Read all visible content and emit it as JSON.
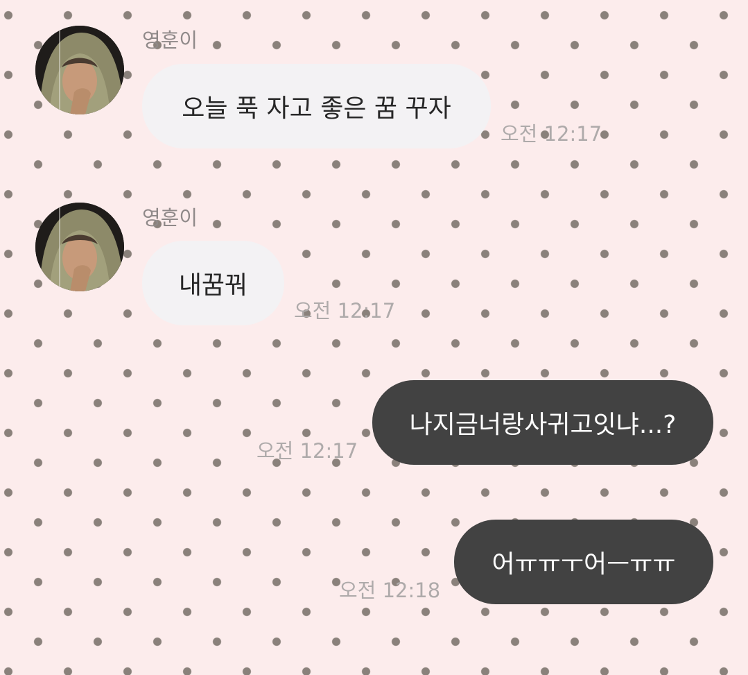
{
  "chat": {
    "messages": [
      {
        "direction": "incoming",
        "sender": "영훈이",
        "avatar_icon": "profile-photo-hoodie",
        "text": "오늘 푹 자고 좋은 꿈 꾸자",
        "time": "오전 12:17"
      },
      {
        "direction": "incoming",
        "sender": "영훈이",
        "avatar_icon": "profile-photo-hoodie",
        "text": "내꿈꿔",
        "time": "오전 12:17"
      },
      {
        "direction": "outgoing",
        "text": "나지금너랑사귀고잇냐...?",
        "time": "오전 12:17"
      },
      {
        "direction": "outgoing",
        "text": "어ㅠㅠㅜ어ㅡㅠㅠ",
        "time": "오전 12:18"
      }
    ]
  },
  "colors": {
    "background": "#fcecec",
    "dots": "#8a817b",
    "incoming_bubble": "#f3f2f4",
    "outgoing_bubble": "#424242",
    "timestamp": "#aeaaaa",
    "sender_name": "#8f8989"
  }
}
